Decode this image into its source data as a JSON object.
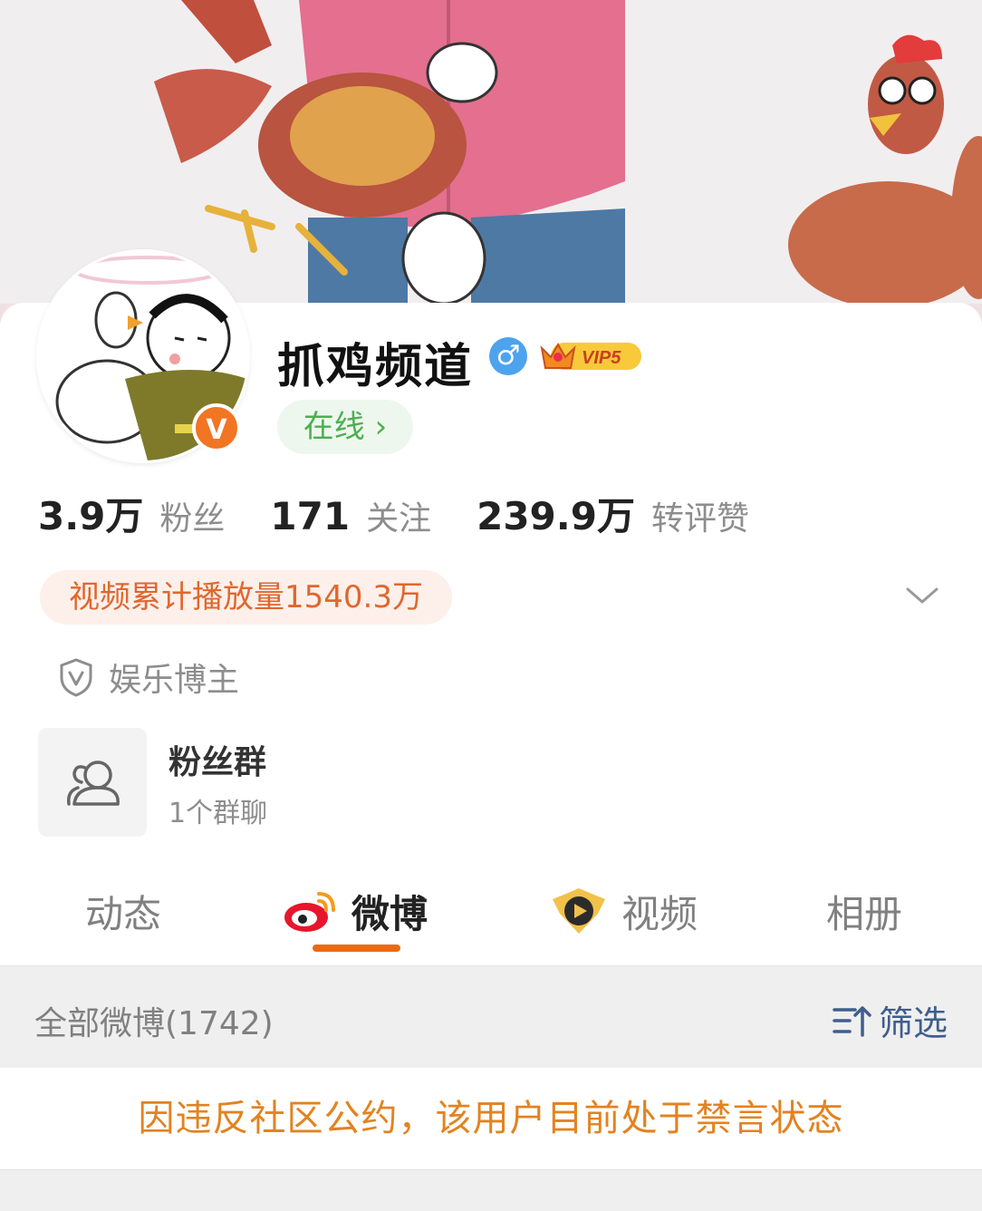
{
  "profile": {
    "name": "抓鸡频道",
    "gender_symbol": "♂",
    "vip_label": "VIP5",
    "verified_mark": "V",
    "online_label": "在线",
    "online_chevron": "›"
  },
  "stats": [
    {
      "num": "3.9万",
      "label": "粉丝"
    },
    {
      "num": "171",
      "label": "关注"
    },
    {
      "num": "239.9万",
      "label": "转评赞"
    }
  ],
  "play_count_text": "视频累计播放量1540.3万",
  "tag_text": "娱乐博主",
  "fan_group": {
    "title": "粉丝群",
    "subtitle": "1个群聊"
  },
  "tabs": [
    {
      "label": "动态",
      "icon": ""
    },
    {
      "label": "微博",
      "icon": "weibo-icon"
    },
    {
      "label": "视频",
      "icon": "video-play-icon"
    },
    {
      "label": "相册",
      "icon": ""
    }
  ],
  "filter_bar": {
    "all_posts": "全部微博(1742)",
    "filter_label": "筛选",
    "filter_icon": "sort-filter-icon"
  },
  "notice": "因违反社区公约，该用户目前处于禁言状态",
  "colors": {
    "accent_orange": "#ea6a12",
    "online_green": "#4caf50",
    "notice_orange": "#e28320",
    "filter_blue": "#3f5e8d",
    "gender_blue": "#4ea3ef"
  }
}
